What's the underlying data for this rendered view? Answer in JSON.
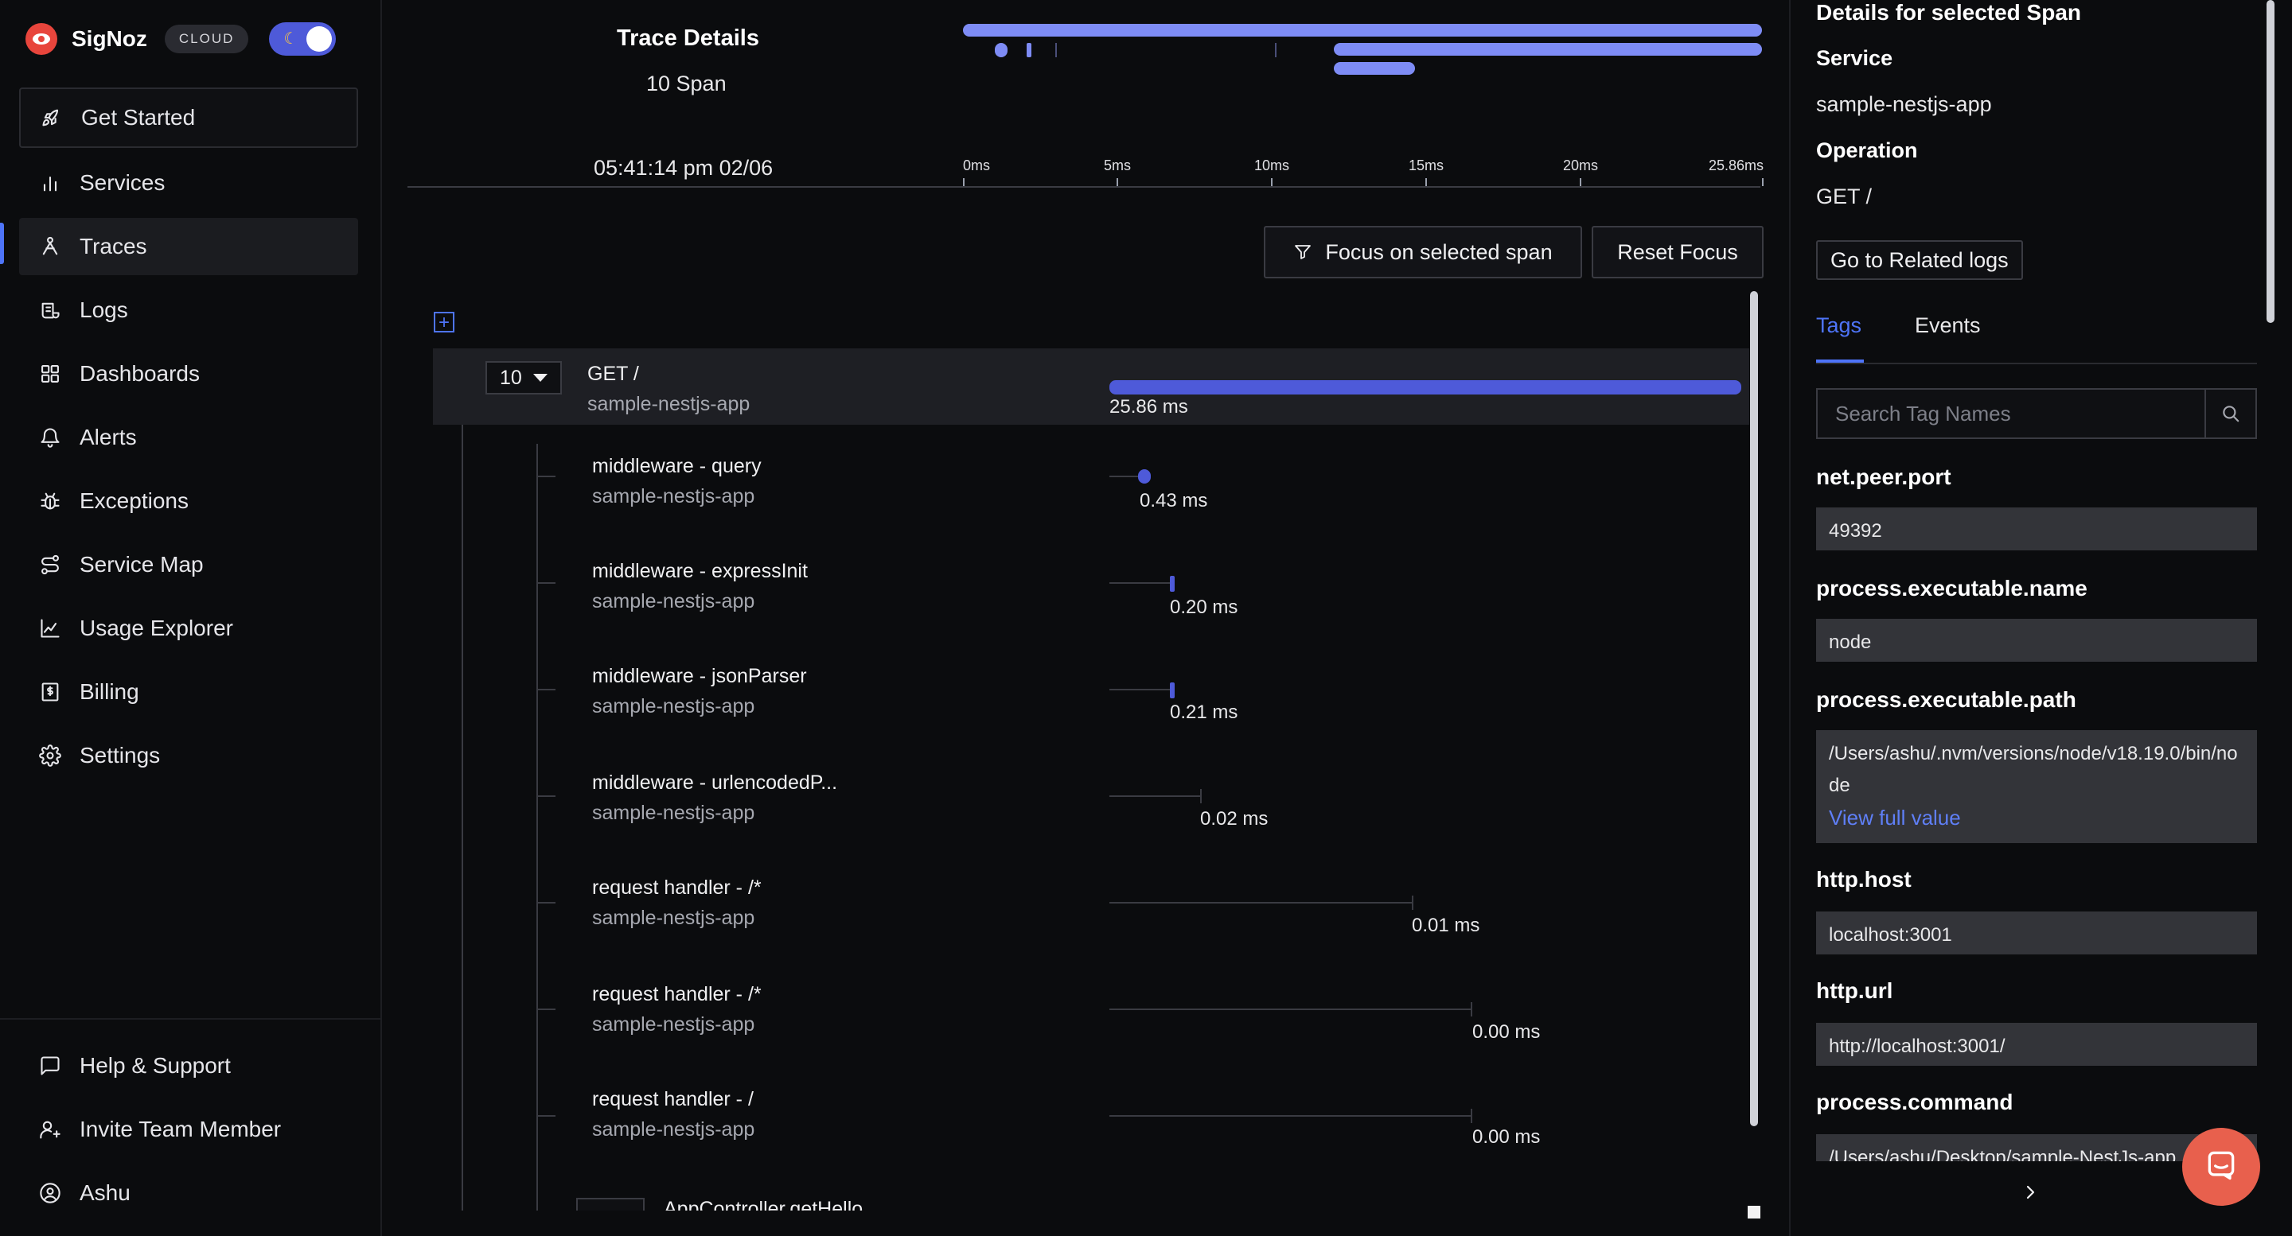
{
  "brand": {
    "name": "SigNoz",
    "badge": "CLOUD"
  },
  "nav": {
    "items": [
      {
        "label": "Get Started",
        "icon": "rocket-icon"
      },
      {
        "label": "Services",
        "icon": "bar-chart-icon"
      },
      {
        "label": "Traces",
        "icon": "traces-icon"
      },
      {
        "label": "Logs",
        "icon": "logs-icon"
      },
      {
        "label": "Dashboards",
        "icon": "grid-icon"
      },
      {
        "label": "Alerts",
        "icon": "bell-icon"
      },
      {
        "label": "Exceptions",
        "icon": "bug-icon"
      },
      {
        "label": "Service Map",
        "icon": "route-icon"
      },
      {
        "label": "Usage Explorer",
        "icon": "line-chart-icon"
      },
      {
        "label": "Billing",
        "icon": "receipt-icon"
      },
      {
        "label": "Settings",
        "icon": "gear-icon"
      }
    ],
    "bottom": [
      {
        "label": "Help & Support",
        "icon": "message-icon"
      },
      {
        "label": "Invite Team Member",
        "icon": "user-plus-icon"
      },
      {
        "label": "Ashu",
        "icon": "user-circle-icon"
      }
    ]
  },
  "trace": {
    "title": "Trace Details",
    "span_count": "10 Span",
    "timestamp": "05:41:14 pm 02/06",
    "axis_labels": [
      "0ms",
      "5ms",
      "10ms",
      "15ms",
      "20ms",
      "25.86ms"
    ],
    "focus_label": "Focus on selected span",
    "reset_label": "Reset Focus",
    "root": {
      "count": "10",
      "name": "GET /",
      "service": "sample-nestjs-app",
      "duration": "25.86 ms"
    },
    "children": [
      {
        "name": "middleware - query",
        "service": "sample-nestjs-app",
        "duration": "0.43 ms"
      },
      {
        "name": "middleware - expressInit",
        "service": "sample-nestjs-app",
        "duration": "0.20 ms"
      },
      {
        "name": "middleware - jsonParser",
        "service": "sample-nestjs-app",
        "duration": "0.21 ms"
      },
      {
        "name": "middleware - urlencodedP...",
        "service": "sample-nestjs-app",
        "duration": "0.02 ms"
      },
      {
        "name": "request handler - /*",
        "service": "sample-nestjs-app",
        "duration": "0.01 ms"
      },
      {
        "name": "request handler - /*",
        "service": "sample-nestjs-app",
        "duration": "0.00 ms"
      },
      {
        "name": "request handler - /",
        "service": "sample-nestjs-app",
        "duration": "0.00 ms"
      },
      {
        "name": "AppController.getHello",
        "service": "",
        "duration": ""
      }
    ]
  },
  "details": {
    "heading": "Details for selected Span",
    "service_label": "Service",
    "service_value": "sample-nestjs-app",
    "operation_label": "Operation",
    "operation_value": "GET /",
    "related_logs_label": "Go to Related logs",
    "tabs": [
      "Tags",
      "Events"
    ],
    "search_placeholder": "Search Tag Names",
    "view_full_label": "View full value",
    "tags": [
      {
        "name": "net.peer.port",
        "value": "49392"
      },
      {
        "name": "process.executable.name",
        "value": "node"
      },
      {
        "name": "process.executable.path",
        "value": "/Users/ashu/.nvm/versions/node/v18.19.0/bin/node"
      },
      {
        "name": "http.host",
        "value": "localhost:3001"
      },
      {
        "name": "http.url",
        "value": "http://localhost:3001/"
      },
      {
        "name": "process.command",
        "value": "/Users/ashu/Desktop/sample-NestJs-app"
      }
    ]
  },
  "colors": {
    "accent": "#4e74f8",
    "span_bar": "#4e5ad9",
    "minimap_bar": "#7e8cf5",
    "logo": "#e8453c",
    "chat": "#e8604d"
  }
}
